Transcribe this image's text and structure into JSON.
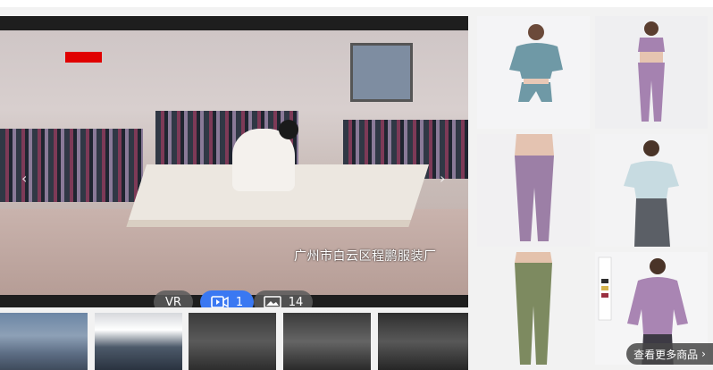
{
  "hero": {
    "caption": "广州市白云区程鹏服装厂",
    "vr_label": "VR",
    "video_count": "1",
    "photo_count": "14",
    "accent_color": "#3a78f2",
    "tag_color": "#e00000",
    "prev_icon": "chevron-left-icon",
    "next_icon": "chevron-right-icon"
  },
  "thumbnails": [
    {
      "name": "factory-building-thumb"
    },
    {
      "name": "office-staff-thumb"
    },
    {
      "name": "warehouse-aisle-thumb"
    },
    {
      "name": "workshop-floor-thumb"
    },
    {
      "name": "storage-shelves-thumb"
    }
  ],
  "products": [
    {
      "name": "teal-crop-top-set"
    },
    {
      "name": "purple-bra-legging-set"
    },
    {
      "name": "purple-leggings"
    },
    {
      "name": "mint-crop-tee-set"
    },
    {
      "name": "olive-leggings"
    },
    {
      "name": "purple-zip-jacket"
    }
  ],
  "more_button": {
    "label": "查看更多商品",
    "icon": "chevron-right-icon"
  }
}
